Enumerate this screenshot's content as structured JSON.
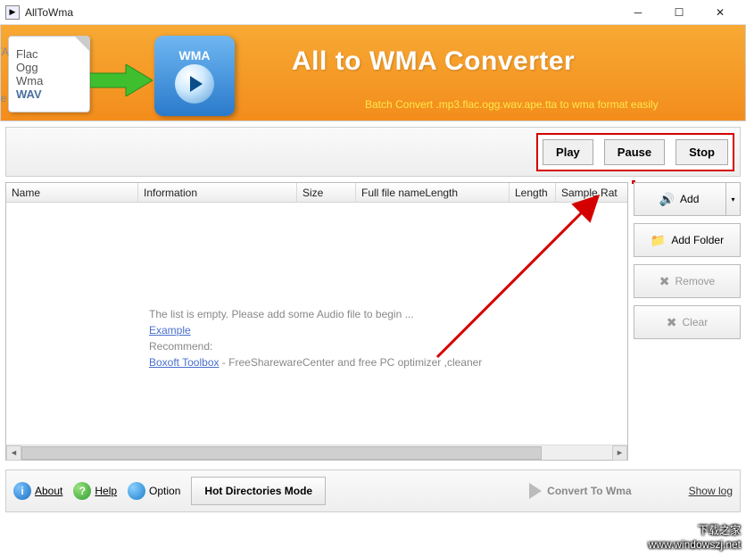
{
  "window": {
    "title": "AllToWma"
  },
  "banner": {
    "title": "All to WMA Converter",
    "subtitle": "Batch Convert .mp3.flac.ogg.wav.ape.tta to wma  format easily",
    "left_formats": [
      "Flac",
      "Ogg",
      "Wma",
      "WAV"
    ],
    "left_side": "TTA",
    "left_side2": "Ape",
    "wma_label": "WMA"
  },
  "play_controls": {
    "play": "Play",
    "pause": "Pause",
    "stop": "Stop"
  },
  "grid": {
    "columns": [
      "Name",
      "Information",
      "Size",
      "Full file nameLength",
      "Length",
      "Sample Rat"
    ],
    "empty_line1": "The list is empty. Please add some Audio file to begin ...",
    "example_link": "Example",
    "recommend_label": "Recommend:",
    "toolbox_link": "Boxoft Toolbox",
    "toolbox_desc": "  - FreeSharewareCenter and free PC optimizer ,cleaner"
  },
  "sidebar": {
    "add": "Add",
    "add_folder": "Add Folder",
    "remove": "Remove",
    "clear": "Clear"
  },
  "footer": {
    "about": "About",
    "help": "Help",
    "option": "Option",
    "hot_mode": "Hot Directories Mode",
    "convert": "Convert To Wma",
    "show_log": "Show log"
  },
  "watermark": {
    "line1": "下载之家",
    "line2": "www.windowszj.net"
  }
}
